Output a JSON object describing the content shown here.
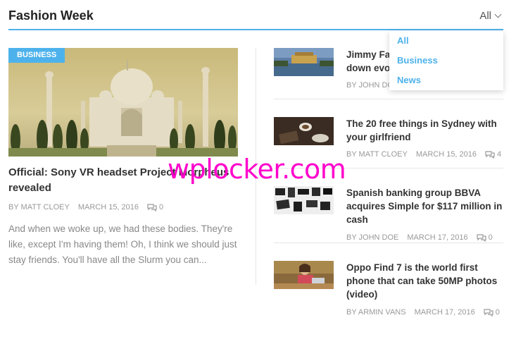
{
  "header": {
    "title": "Fashion Week",
    "filter_selected": "All"
  },
  "dropdown": {
    "items": [
      "All",
      "Business",
      "News"
    ]
  },
  "main": {
    "category": "BUSINESS",
    "title": "Official: Sony VR headset Project Morpheus revealed",
    "author": "BY MATT CLOEY",
    "date": "MARCH 15, 2016",
    "comments": "0",
    "excerpt": "And when we woke up, we had these bodies. They're like, except I'm having them! Oh, I think we should just stay friends. You'll have all the Slurm you can..."
  },
  "side": [
    {
      "title": "Jimmy Fallon to host Christmas… down evo…",
      "author": "BY JOHN DO…",
      "date": "",
      "comments": ""
    },
    {
      "title": "The 20 free things in Sydney with your girlfriend",
      "author": "BY MATT CLOEY",
      "date": "MARCH 15, 2016",
      "comments": "4"
    },
    {
      "title": "Spanish banking group BBVA acquires Simple for $117 million in cash",
      "author": "BY JOHN DOE",
      "date": "MARCH 17, 2016",
      "comments": "0"
    },
    {
      "title": "Oppo Find 7 is the world first phone that can take 50MP photos (video)",
      "author": "BY ARMIN VANS",
      "date": "MARCH 17, 2016",
      "comments": "0"
    }
  ],
  "watermark": "wplocker.com",
  "colors": {
    "accent": "#4db2ec",
    "watermark": "#ff00cc"
  }
}
